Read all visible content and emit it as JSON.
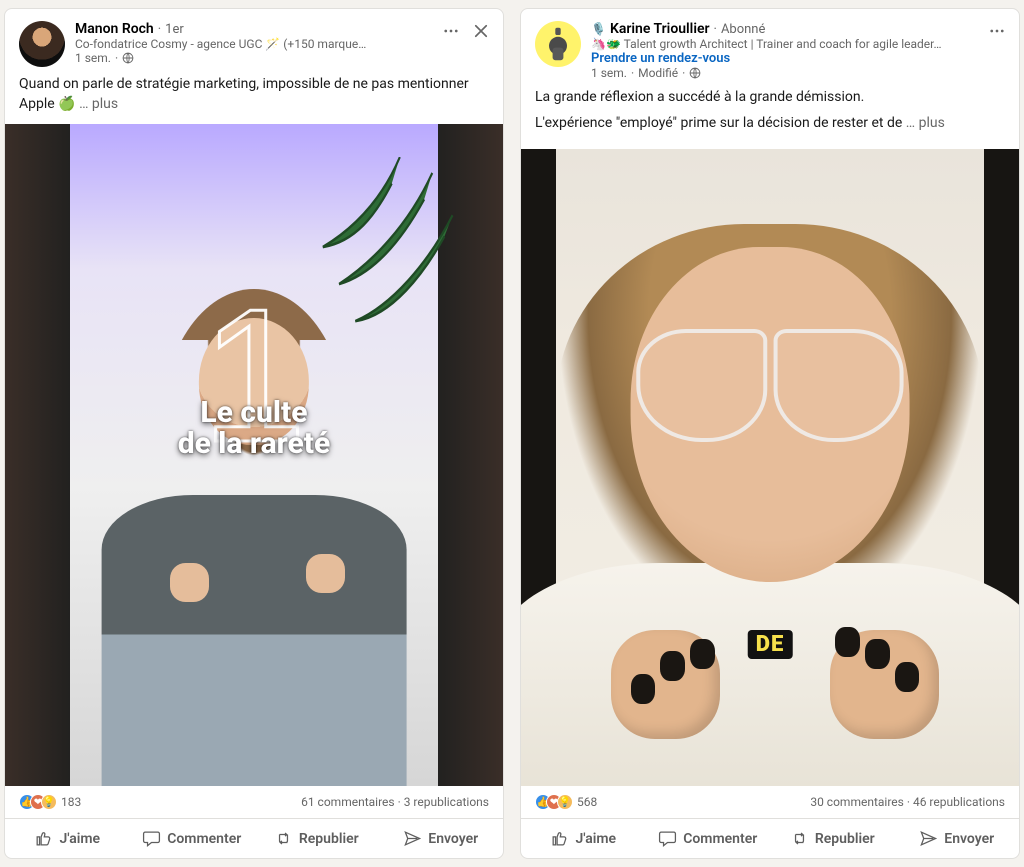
{
  "posts": [
    {
      "author": {
        "name": "Manon Roch",
        "badge": "1er",
        "subtitle": "Co-fondatrice Cosmy - agence UGC 🪄 (+150 marque…",
        "cta": "",
        "meta_time": "1 sem.",
        "meta_edited": "",
        "visibility": "public"
      },
      "text": "Quand on parle de stratégie marketing, impossible de ne pas mentionner Apple 🍏",
      "more": "… plus",
      "video_overlay_big": "1",
      "video_caption_line1": "Le culte",
      "video_caption_line2": "de la rareté",
      "reactions_count": "183",
      "comments_label": "61 commentaires",
      "reposts_label": "3 republications"
    },
    {
      "author": {
        "name": "Karine Trioullier",
        "badge": "Abonné",
        "subtitle": "🦄🐲 Talent growth Architect | Trainer and coach for agile leader…",
        "cta": "Prendre un rendez-vous",
        "meta_time": "1 sem.",
        "meta_edited": "Modifié",
        "visibility": "public"
      },
      "text_p1": "La grande réflexion a succédé à la grande démission.",
      "text_p2": "L'expérience \"employé\" prime sur la décision de rester et de",
      "more": "… plus",
      "video_caption_word": "DE",
      "reactions_count": "568",
      "comments_label": "30 commentaires",
      "reposts_label": "46 republications"
    }
  ],
  "ui": {
    "like": "J'aime",
    "comment": "Commenter",
    "repost": "Republier",
    "send": "Envoyer",
    "sep": " · "
  }
}
